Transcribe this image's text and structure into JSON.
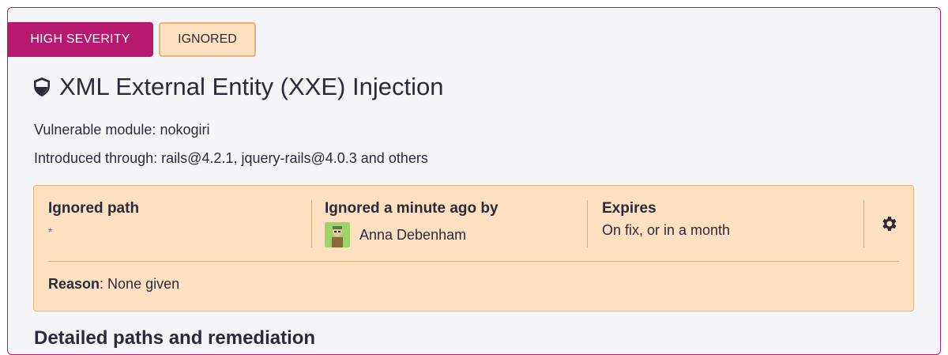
{
  "badges": {
    "severity": "HIGH SEVERITY",
    "status": "IGNORED"
  },
  "issue": {
    "title": "XML External Entity (XXE) Injection",
    "module_label": "Vulnerable module:",
    "module": "nokogiri",
    "introduced_label": "Introduced through:",
    "introduced": "rails@4.2.1, jquery-rails@4.0.3 and others"
  },
  "ignore": {
    "path_label": "Ignored path",
    "path_value": "*",
    "by_label": "Ignored a minute ago by",
    "by_user": "Anna Debenham",
    "expires_label": "Expires",
    "expires_value": "On fix, or in a month",
    "reason_label": "Reason",
    "reason_value": "None given"
  },
  "section_title": "Detailed paths and remediation",
  "icons": {
    "title_icon": "shield-icon",
    "settings_icon": "gear-icon",
    "avatar": "user-avatar"
  },
  "colors": {
    "severity": "#b6196e",
    "ignored_bg": "#ffe0c0",
    "ignored_border": "#e9b37a"
  }
}
